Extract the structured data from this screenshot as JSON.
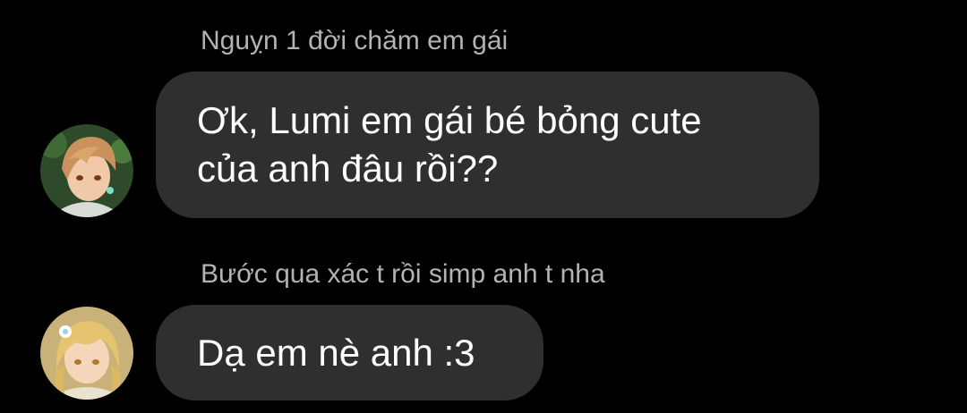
{
  "messages": [
    {
      "sender": "Nguỵn 1 đời chăm em gái",
      "avatar_icon": "avatar-boy-character-icon",
      "lines": [
        "Ơk, Lumi em gái bé bỏng cute",
        "của anh đâu rồi??"
      ]
    },
    {
      "sender": "Bước qua xác t rồi simp anh t nha",
      "avatar_icon": "avatar-girl-character-icon",
      "lines": [
        "Dạ em nè anh :3"
      ]
    }
  ],
  "colors": {
    "background": "#000000",
    "bubble": "#2f2f2f",
    "message_text": "#ffffff",
    "sender_text": "#b3b3b3"
  }
}
